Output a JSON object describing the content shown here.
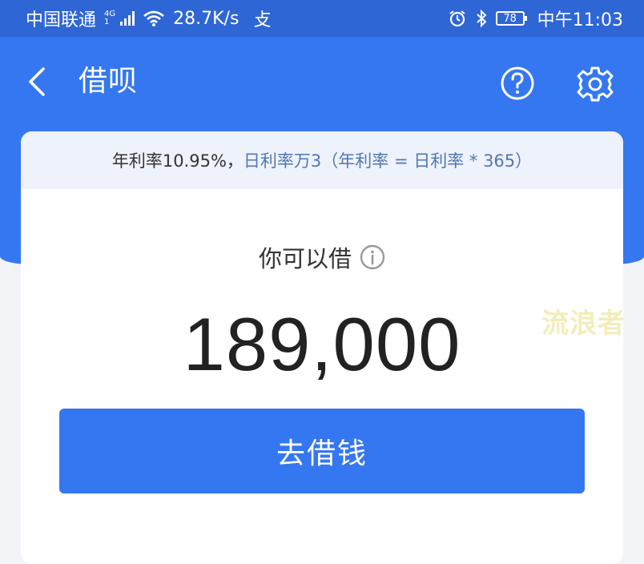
{
  "status_bar": {
    "carrier": "中国联通",
    "network_type": "4G",
    "net_sub": "1",
    "speed": "28.7K/s",
    "extra_icon": "攴",
    "battery_level": "78",
    "time": "中午11:03",
    "icons": [
      "signal-icon",
      "wifi-icon",
      "alarm-icon",
      "bluetooth-icon",
      "battery-icon"
    ]
  },
  "header": {
    "title": "借呗",
    "back_icon": "back-arrow-icon",
    "help_icon": "question-circle-icon",
    "settings_icon": "gear-icon"
  },
  "card": {
    "rate_primary": "年利率10.95%，",
    "rate_secondary": "日利率万3（年利率 = 日利率 * 365）",
    "borrow_label": "你可以借",
    "info_icon": "info-circle-icon",
    "amount": "189,000",
    "cta_label": "去借钱"
  },
  "watermark": "流浪者",
  "colors": {
    "brand_blue": "#3577f0",
    "status_bar_blue": "#2f66d6",
    "rate_bar_bg": "#edf2fb",
    "rate_secondary": "#5377b2",
    "watermark": "#f3edbb"
  }
}
